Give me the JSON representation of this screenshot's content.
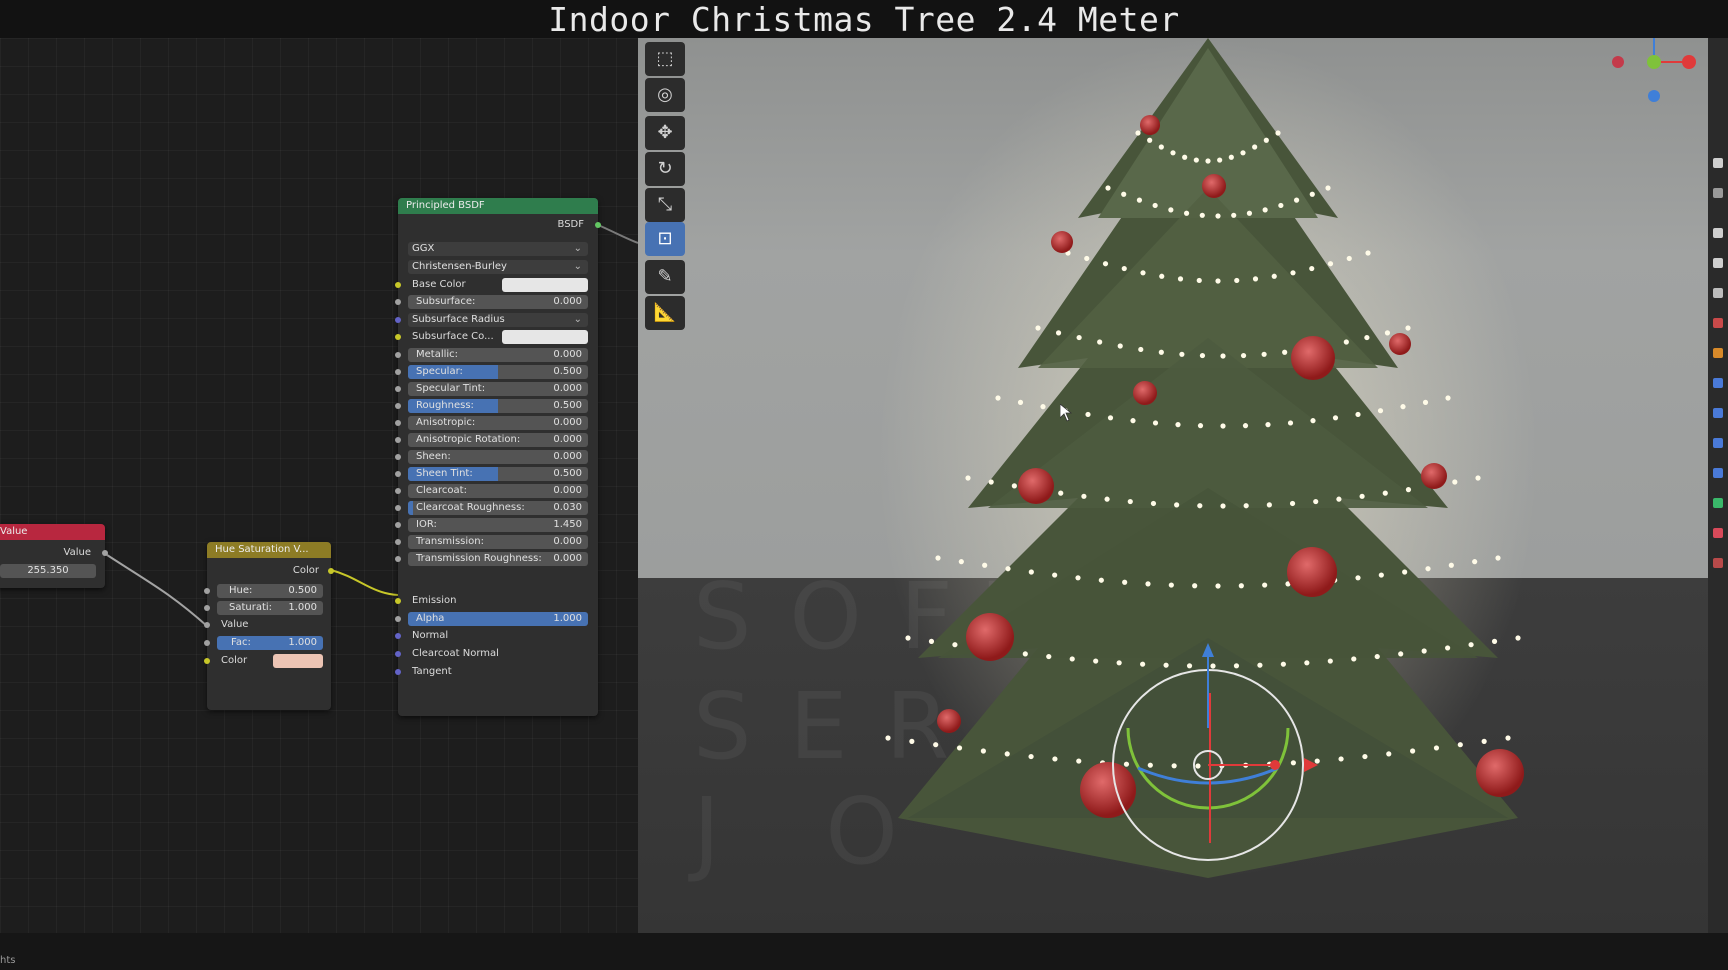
{
  "title": "Indoor Christmas Tree 2.4 Meter",
  "colors": {
    "accent": "#4772b3",
    "value_header": "#b8273f",
    "hue_header": "#8d7c25",
    "bsdf_header": "#2f7d4d",
    "socket_yellow": "#c7c729",
    "socket_blue": "#6363c7",
    "socket_grey": "#a1a1a1"
  },
  "nodes": {
    "value": {
      "header": "Value",
      "output_label": "Value",
      "value": "255.350"
    },
    "hue_saturation": {
      "header": "Hue Saturation V...",
      "output_label": "Color",
      "hue_label": "Hue:",
      "hue_value": "0.500",
      "saturation_label": "Saturati:",
      "saturation_value": "1.000",
      "value_label": "Value",
      "fac_label": "Fac:",
      "fac_value": "1.000",
      "color_label": "Color",
      "color_swatch": "#ecc4b4"
    },
    "principled_bsdf": {
      "header": "Principled BSDF",
      "output_label": "BSDF",
      "distribution": "GGX",
      "subsurface_method": "Christensen-Burley",
      "base_color_label": "Base Color",
      "subsurface_color_label": "Subsurface Co...",
      "subsurface_radius_label": "Subsurface Radius",
      "fields": [
        {
          "label": "Subsurface:",
          "value": "0.000",
          "fill": 0.0
        },
        {
          "label": "Metallic:",
          "value": "0.000",
          "fill": 0.0
        },
        {
          "label": "Specular:",
          "value": "0.500",
          "fill": 0.5
        },
        {
          "label": "Specular Tint:",
          "value": "0.000",
          "fill": 0.0
        },
        {
          "label": "Roughness:",
          "value": "0.500",
          "fill": 0.5
        },
        {
          "label": "Anisotropic:",
          "value": "0.000",
          "fill": 0.0
        },
        {
          "label": "Anisotropic Rotation:",
          "value": "0.000",
          "fill": 0.0
        },
        {
          "label": "Sheen:",
          "value": "0.000",
          "fill": 0.0
        },
        {
          "label": "Sheen Tint:",
          "value": "0.500",
          "fill": 0.5
        },
        {
          "label": "Clearcoat:",
          "value": "0.000",
          "fill": 0.0
        },
        {
          "label": "Clearcoat Roughness:",
          "value": "0.030",
          "fill": 0.03
        },
        {
          "label": "IOR:",
          "value": "1.450",
          "fill": 0.0
        },
        {
          "label": "Transmission:",
          "value": "0.000",
          "fill": 0.0
        },
        {
          "label": "Transmission Roughness:",
          "value": "0.000",
          "fill": 0.0
        }
      ],
      "emission_label": "Emission",
      "alpha_label": "Alpha",
      "alpha_value": "1.000",
      "normal_label": "Normal",
      "clearcoat_normal_label": "Clearcoat Normal",
      "tangent_label": "Tangent"
    }
  },
  "toolbar": {
    "tools": [
      {
        "name": "select-box",
        "glyph": "⬚"
      },
      {
        "name": "cursor",
        "glyph": "◎"
      },
      {
        "name": "move",
        "glyph": "✥"
      },
      {
        "name": "rotate",
        "glyph": "↻"
      },
      {
        "name": "scale",
        "glyph": "⤡"
      },
      {
        "name": "transform",
        "glyph": "⊡"
      },
      {
        "name": "annotate",
        "glyph": "✎"
      },
      {
        "name": "measure",
        "glyph": "📐"
      }
    ]
  },
  "watermark": [
    "SOFT",
    "SER",
    "J  O"
  ],
  "status_text": "hts"
}
